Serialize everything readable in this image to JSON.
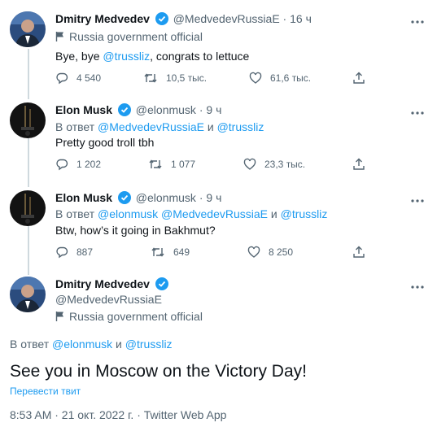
{
  "tweets": [
    {
      "name": "Dmitry Medvedev",
      "handle": "@MedvedevRussiaE",
      "dot": "·",
      "time": "16 ч",
      "label": "Russia government official",
      "text_pre": "Bye, bye ",
      "text_mention": "@trussliz",
      "text_post": ", congrats to lettuce",
      "replies": "4 540",
      "retweets": "10,5 тыс.",
      "likes": "61,6 тыс."
    },
    {
      "name": "Elon Musk",
      "handle": "@elonmusk",
      "dot": "·",
      "time": "9 ч",
      "reply_prefix": "В ответ ",
      "reply_to_1": "@MedvedevRussiaE",
      "reply_and": " и ",
      "reply_to_2": "@trussliz",
      "text": "Pretty good troll tbh",
      "replies": "1 202",
      "retweets": "1 077",
      "likes": "23,3 тыс."
    },
    {
      "name": "Elon Musk",
      "handle": "@elonmusk",
      "dot": "·",
      "time": "9 ч",
      "reply_prefix": "В ответ ",
      "reply_to_1": "@elonmusk @MedvedevRussiaE",
      "reply_and": " и ",
      "reply_to_2": "@trussliz",
      "text": "Btw, how’s it going in Bakhmut?",
      "replies": "887",
      "retweets": "649",
      "likes": "8 250"
    }
  ],
  "main": {
    "name": "Dmitry Medvedev",
    "handle": "@MedvedevRussiaE",
    "label": "Russia government official",
    "reply_prefix": "В ответ ",
    "reply_to_1": "@elonmusk",
    "reply_and": " и ",
    "reply_to_2": "@trussliz",
    "text": "See you in Moscow on the Victory Day!",
    "translate": "Перевести твит",
    "meta": "8:53 AM · 21 окт. 2022 г. · Twitter Web App"
  },
  "colors": {
    "accent": "#1d9bf0",
    "secondary_text": "#536471",
    "primary_text": "#0f1419"
  }
}
